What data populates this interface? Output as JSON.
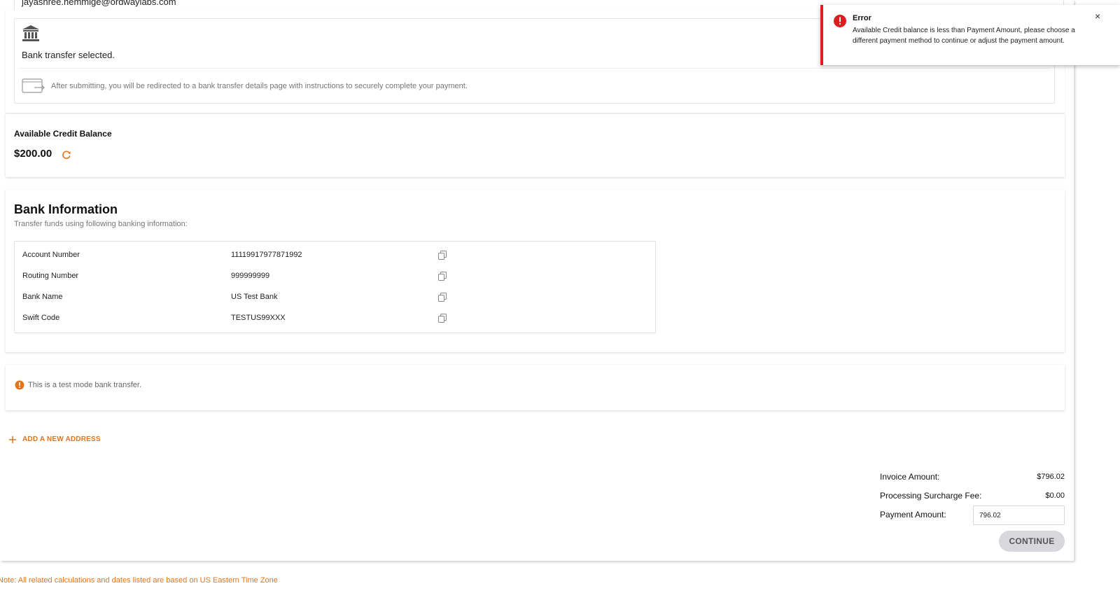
{
  "email_strip": {
    "text": "jayashree.hemmige@ordwaylabs.com"
  },
  "payment_method": {
    "bank_icon": "bank-icon",
    "selected_text": "Bank transfer selected.",
    "redirect_icon": "redirect-arrow-icon",
    "redirect_text": "After submitting, you will be redirected to a bank transfer details page with instructions to securely complete your payment."
  },
  "credit": {
    "title": "Available Credit Balance",
    "value": "$200.00",
    "refresh_icon": "refresh-icon"
  },
  "bank_info": {
    "title": "Bank Information",
    "subtitle": "Transfer funds using following banking information:",
    "rows": [
      {
        "label": "Account Number",
        "value": "11119917977871992"
      },
      {
        "label": "Routing Number",
        "value": "999999999"
      },
      {
        "label": "Bank Name",
        "value": "US Test Bank"
      },
      {
        "label": "Swift Code",
        "value": "TESTUS99XXX"
      }
    ],
    "copy_icon": "copy-icon"
  },
  "test_notice": {
    "text": "This is a test mode bank transfer.",
    "icon": "warning-icon"
  },
  "add_address": {
    "label": "ADD A NEW ADDRESS",
    "icon": "plus-icon"
  },
  "summary": {
    "invoice_label": "Invoice Amount:",
    "invoice_value": "$796.02",
    "surcharge_label": "Processing Surcharge Fee:",
    "surcharge_value": "$0.00",
    "payment_label": "Payment Amount:",
    "payment_value": "796.02"
  },
  "continue_label": "CONTINUE",
  "footer_note": "Note: All related calculations and dates listed are based on US Eastern Time Zone",
  "toast": {
    "title": "Error",
    "message": "Available Credit balance is less than Payment Amount, please choose a different payment method to continue or adjust the payment amount.",
    "icon": "error-icon",
    "close_label": "×"
  },
  "colors": {
    "accent": "#e0751c",
    "error": "#dd1f1f",
    "button_bg": "#d7d7dc"
  }
}
